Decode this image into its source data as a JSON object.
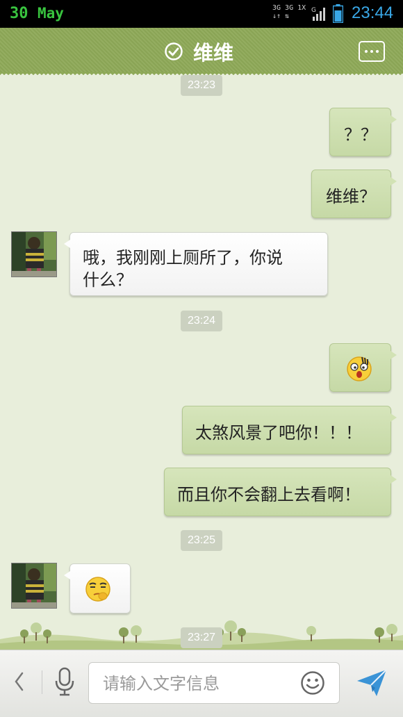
{
  "status_bar": {
    "date_day": "30",
    "date_month": "May",
    "network_top": "3G 3G 1X",
    "network_bottom": "↓↑  ⇅",
    "network_g": "G",
    "time": "23:44"
  },
  "header": {
    "title": "维维"
  },
  "timestamps": [
    "23:23",
    "23:24",
    "23:25",
    "23:27"
  ],
  "messages": [
    {
      "from": "me",
      "text": "？？"
    },
    {
      "from": "me",
      "text": "维维？"
    },
    {
      "from": "contact",
      "text_line1": "哦，我刚刚上厕所了，你说",
      "text_line2": "什么？"
    },
    {
      "from": "me",
      "emoji": "shocked-face"
    },
    {
      "from": "me",
      "text": "太煞风景了吧你！！！"
    },
    {
      "from": "me",
      "text": "而且你不会翻上去看啊！"
    },
    {
      "from": "contact",
      "emoji": "thinking-face"
    }
  ],
  "input_bar": {
    "placeholder": "请输入文字信息"
  },
  "colors": {
    "header": "#8ea958",
    "background": "#e8eedb",
    "outgoing_bubble": "#c9dba9",
    "incoming_bubble": "#ffffff",
    "time_accent": "#39a7e6",
    "date_accent": "#39c43f"
  }
}
